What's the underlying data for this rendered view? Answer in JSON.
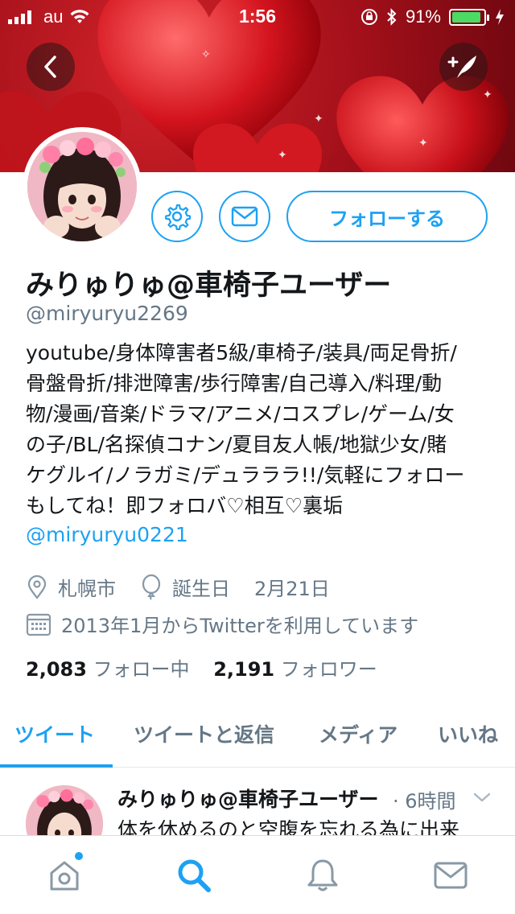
{
  "status_bar": {
    "carrier": "au",
    "time": "1:56",
    "battery": "91%",
    "battery_level": 0.91
  },
  "header": {
    "back_icon": "chevron-left-icon",
    "compose_icon": "compose-tweet-icon"
  },
  "profile": {
    "name": "みりゅりゅ@車椅子ユーザー",
    "handle": "@miryuryu2269",
    "follow_label": "フォローする",
    "bio_lines": [
      "youtube/身体障害者5級/車椅子/装具/両足骨折/",
      "骨盤骨折/排泄障害/歩行障害/自己導入/料理/動",
      "物/漫画/音楽/ドラマ/アニメ/コスプレ/ゲーム/女",
      "の子/BL/名探偵コナン/夏目友人帳/地獄少女/賭",
      "ケグルイ/ノラガミ/デュラララ!!/気軽にフォロー",
      "もしてね！即フォロバ♡相互♡裏垢"
    ],
    "bio_link": "@miryuryu0221",
    "location": "札幌市",
    "birthday_label": "誕生日",
    "birthday": "2月21日",
    "joined": "2013年1月からTwitterを利用しています",
    "following_count": "2,083",
    "following_label": "フォロー中",
    "followers_count": "2,191",
    "followers_label": "フォロワー"
  },
  "tabs": [
    {
      "label": "ツイート",
      "active": true
    },
    {
      "label": "ツイートと返信",
      "active": false
    },
    {
      "label": "メディア",
      "active": false
    },
    {
      "label": "いいね",
      "active": false
    }
  ],
  "tweet": {
    "name": "みりゅりゅ@車椅子ユーザー",
    "time": "· 6時間",
    "text": "体を休めるのと空腹を忘れる為に出来"
  },
  "colors": {
    "accent": "#1da1f2",
    "text": "#14171a",
    "muted": "#657786",
    "banner": "#b0141c"
  }
}
